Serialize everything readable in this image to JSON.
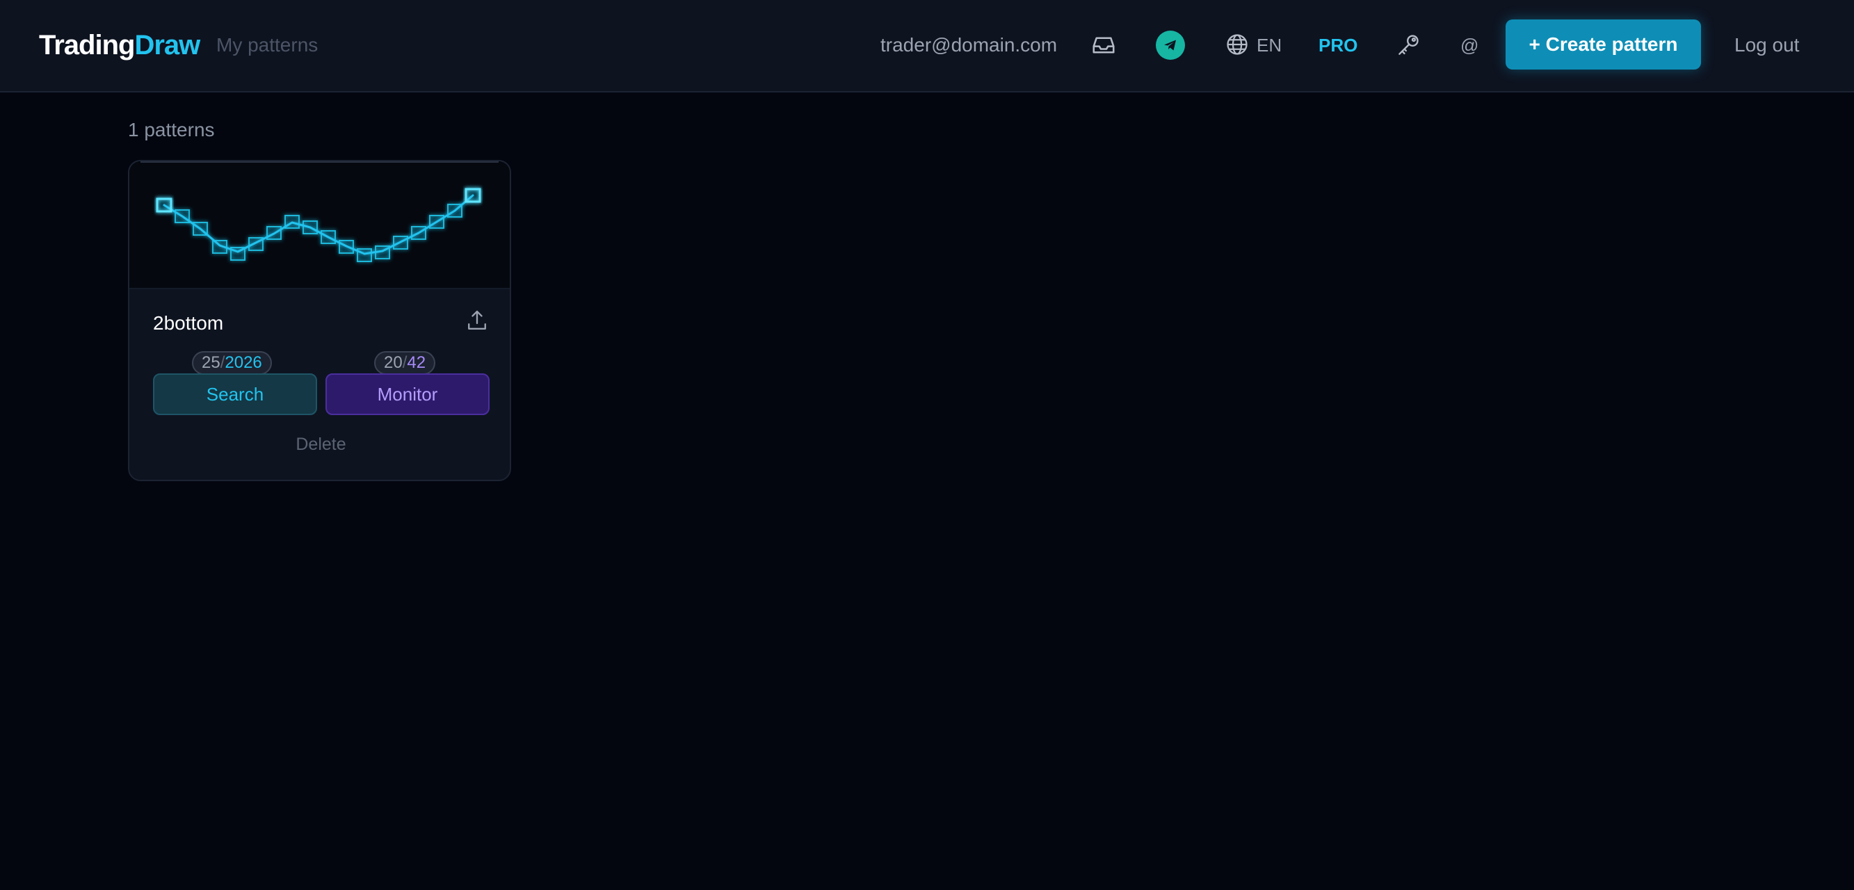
{
  "header": {
    "logo_part1": "Trading",
    "logo_part2": "Draw",
    "nav_my_patterns": "My patterns",
    "email": "trader@domain.com",
    "language": "EN",
    "pro_label": "PRO",
    "at_label": "@",
    "create_button": "+ Create pattern",
    "logout": "Log out",
    "icons": [
      "inbox-icon",
      "telegram-icon",
      "globe-icon",
      "key-icon"
    ]
  },
  "main": {
    "count_label": "1 patterns"
  },
  "pattern_card": {
    "title": "2bottom",
    "share_icon": "share-icon",
    "search_badge": {
      "used": "25",
      "sep": "/",
      "total": "2026"
    },
    "monitor_badge": {
      "used": "20",
      "sep": "/",
      "total": "42"
    },
    "search_button": "Search",
    "monitor_button": "Monitor",
    "delete_button": "Delete"
  },
  "colors": {
    "accent": "#22c3ee",
    "purple": "#a78bfa",
    "background": "#03060f",
    "header_bg": "#0e1320"
  }
}
